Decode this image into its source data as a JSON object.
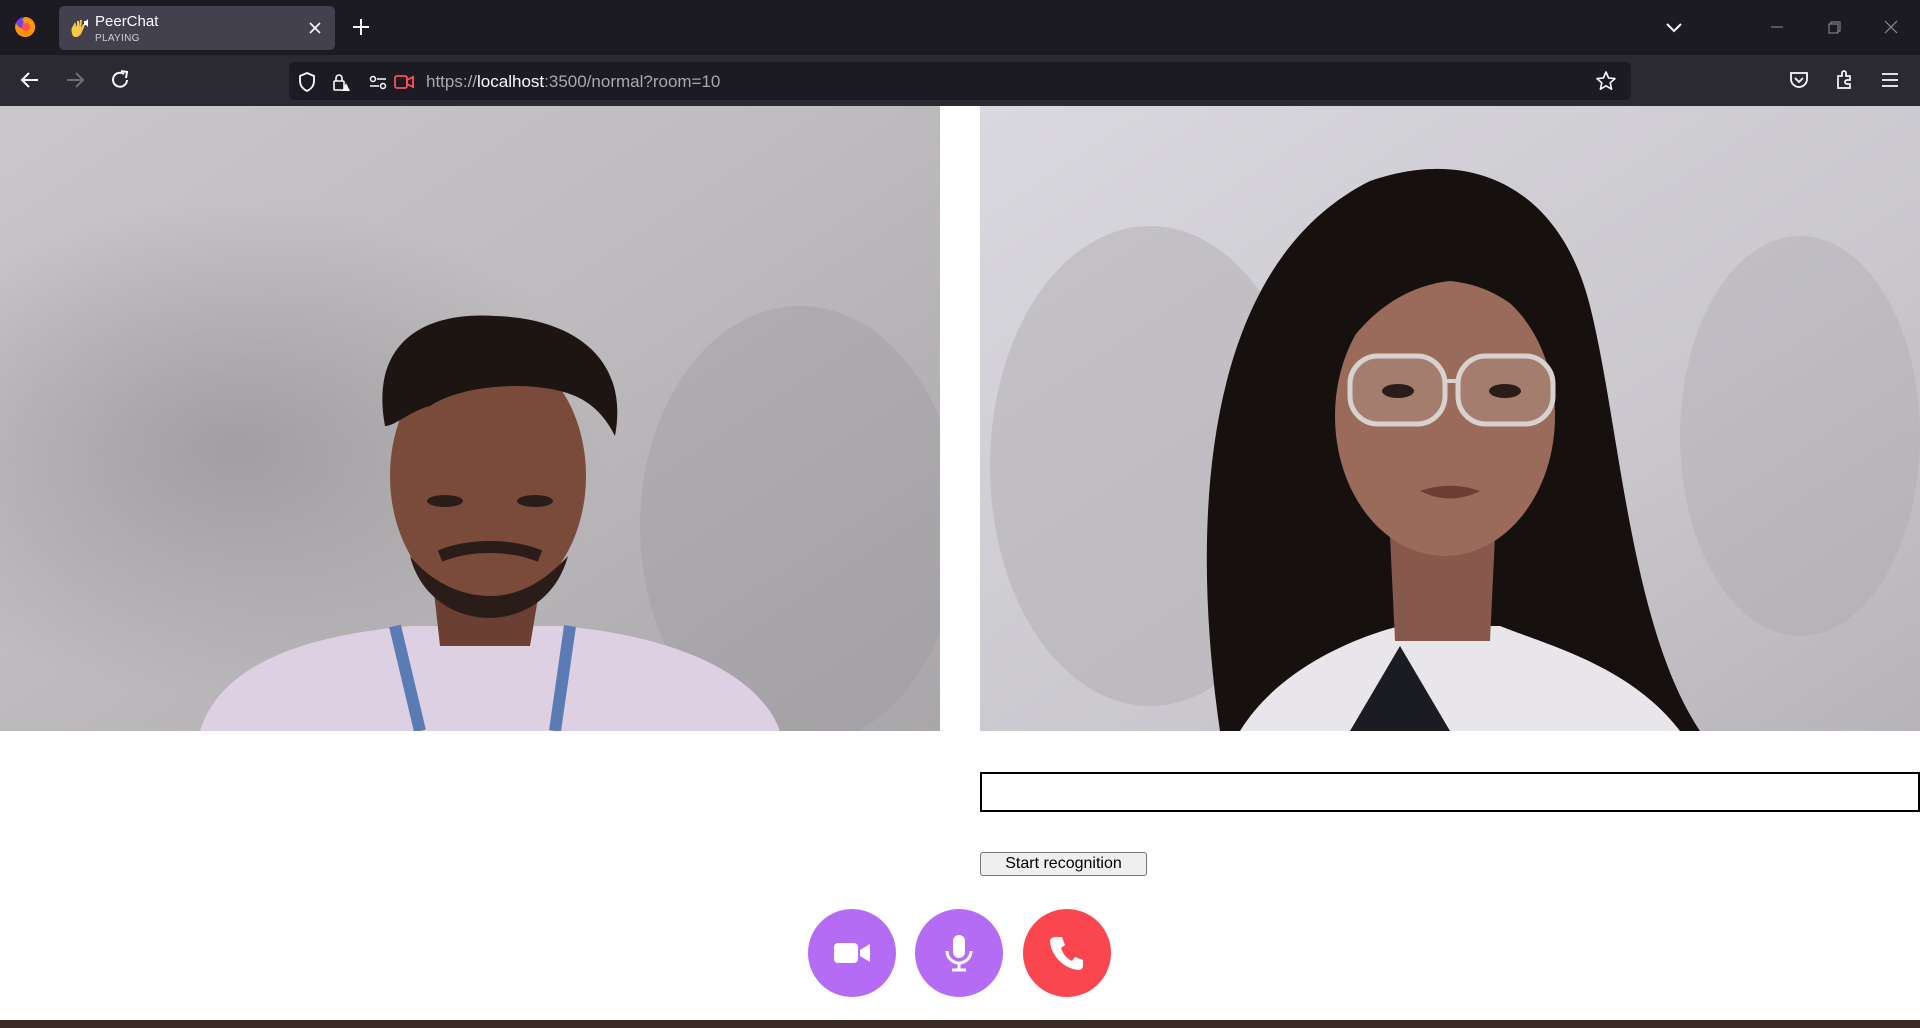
{
  "browser": {
    "tab": {
      "title": "PeerChat",
      "subtitle": "PLAYING"
    },
    "url": {
      "scheme": "https://",
      "host": "localhost",
      "rest": ":3500/normal?room=10"
    }
  },
  "call": {
    "caption_text": "",
    "recognition_button": "Start recognition",
    "controls": [
      {
        "icon": "video-camera-icon",
        "color": "#b56cf5"
      },
      {
        "icon": "microphone-icon",
        "color": "#b56cf5"
      },
      {
        "icon": "phone-hangup-icon",
        "color": "#f9464f"
      }
    ]
  }
}
